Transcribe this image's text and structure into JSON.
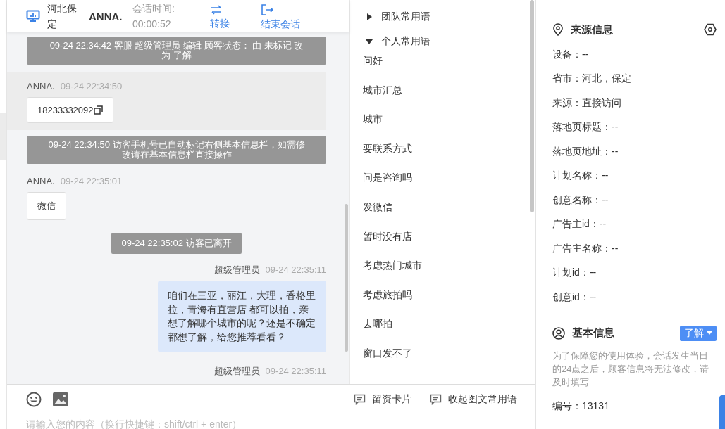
{
  "header": {
    "location": "河北保定",
    "visitor": "ANNA.",
    "session_label": "会话时间:",
    "session_time": "00:00:52",
    "actions": [
      {
        "kind": "transfer",
        "label": "转接"
      },
      {
        "kind": "end",
        "label": "结束会话"
      }
    ]
  },
  "messages": [
    {
      "kind": "system",
      "text": "09-24 22:34:42 客服 超级管理员 编辑 顾客状态： 由 未标记 改为 了解"
    },
    {
      "kind": "visitor",
      "name": "ANNA.",
      "time": "09-24 22:34:50",
      "text": "18233332092",
      "copyable": true,
      "highlighted": true
    },
    {
      "kind": "system",
      "text": "09-24 22:34:50 访客手机号已自动标记右侧基本信息栏，如需修改请在基本信息栏直接操作"
    },
    {
      "kind": "visitor",
      "name": "ANNA.",
      "time": "09-24 22:35:01",
      "text": "微信",
      "copyable": false,
      "highlighted": false
    },
    {
      "kind": "notice",
      "text": "09-24 22:35:02 访客已离开"
    },
    {
      "kind": "agent",
      "name": "超级管理员",
      "time": "09-24 22:35:11",
      "text": "咱们在三亚，丽江，大理，香格里拉，青海有直营店 都可以拍，亲想了解哪个城市的呢？还是不确定都想了解，给您推荐看看？"
    },
    {
      "kind": "agent",
      "name": "超级管理员",
      "time": "09-24 22:35:11"
    }
  ],
  "phrase_groups": [
    {
      "title": "团队常用语",
      "expanded": false
    },
    {
      "title": "个人常用语",
      "expanded": true,
      "items": [
        "问好",
        "城市汇总",
        "城市",
        "要联系方式",
        "问是咨询吗",
        "发微信",
        "暂时没有店",
        "考虑热门城市",
        "考虑旅拍吗",
        "去哪拍",
        "窗口发不了"
      ]
    }
  ],
  "toolbar": {
    "actions": [
      "留资卡片",
      "收起图文常用语"
    ]
  },
  "input": {
    "placeholder": "请输入您的内容（换行快捷键：shift/ctrl + enter）"
  },
  "source_info": {
    "title": "来源信息",
    "fields": [
      "设备：--",
      "省市：河北，保定",
      "来源：直接访问",
      "落地页标题：--",
      "落地页地址：--",
      "计划名称：--",
      "创意名称：--",
      "广告主id：--",
      "广告主名称：--",
      "计划id：--",
      "创意id：--"
    ]
  },
  "basic_info": {
    "title": "基本信息",
    "status": "了解",
    "note": "为了保障您的使用体验，会话发生当日的24点之后，顾客信息将无法修改，请及时填写",
    "fields": [
      "编号：13131"
    ]
  }
}
